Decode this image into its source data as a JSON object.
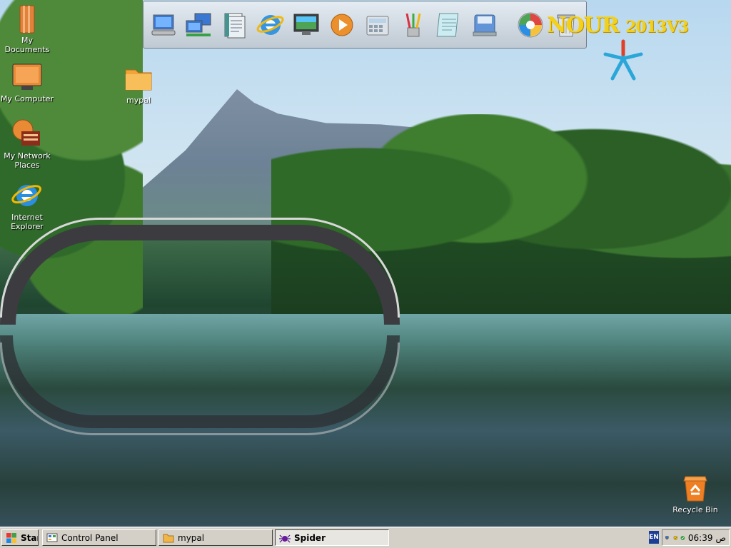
{
  "desktop": {
    "icons": [
      {
        "label": "My Documents"
      },
      {
        "label": "My Computer"
      },
      {
        "label": "My Network Places"
      },
      {
        "label": "Internet Explorer"
      },
      {
        "label": "mypal"
      },
      {
        "label": "Recycle Bin"
      }
    ]
  },
  "dock": {
    "items": [
      {
        "icon": "my-computer-icon"
      },
      {
        "icon": "network-computers-icon"
      },
      {
        "icon": "documents-icon"
      },
      {
        "icon": "internet-explorer-icon"
      },
      {
        "icon": "monitor-display-icon"
      },
      {
        "icon": "media-player-icon"
      },
      {
        "icon": "calculator-icon"
      },
      {
        "icon": "paint-brushes-icon"
      },
      {
        "icon": "notepad-icon"
      },
      {
        "icon": "disk-drive-icon"
      },
      {
        "icon": "windows-logo-icon"
      },
      {
        "icon": "recycle-bin-icon"
      }
    ]
  },
  "brand": {
    "name": "NOUR",
    "version": "2013V3"
  },
  "taskbar": {
    "start_label": "Start",
    "tasks": [
      {
        "label": "Control Panel",
        "active": false
      },
      {
        "label": "mypal",
        "active": false
      },
      {
        "label": "Spider",
        "active": true
      }
    ],
    "language": "EN",
    "clock": "06:39",
    "clock_suffix": "ص"
  },
  "colors": {
    "brand_yellow": "#f3d11a",
    "taskbar_gray": "#d4d0c8",
    "star_blue": "#2aa6d8",
    "star_red": "#e0402a"
  }
}
